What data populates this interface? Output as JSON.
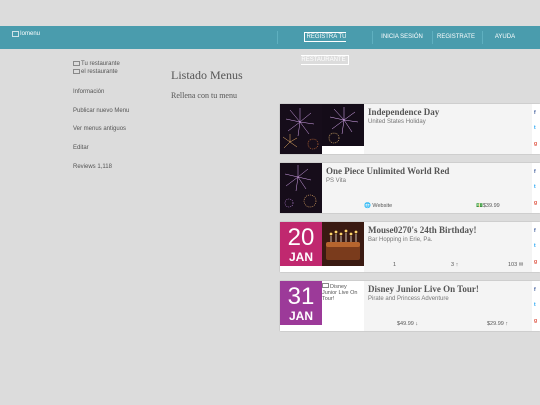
{
  "header": {
    "brand_alt": "Iomenu",
    "nav": [
      "REGISTRA TU RESTAURANTE",
      "INICIA SESIÓN",
      "REGISTRATE",
      "AYUDA"
    ]
  },
  "sidebar": {
    "title": "Tu restaurante",
    "logo_alt": "el restaurante",
    "items": [
      "Información",
      "Publicar nuevo Menu",
      "Ver menus antiguos",
      "Editar",
      "Reviews 1,118"
    ]
  },
  "main": {
    "title": "Listado Menus",
    "subtitle": "Rellena con tu menu"
  },
  "cards": [
    {
      "title": "Independence Day",
      "subtitle": "United States Holiday"
    },
    {
      "title": "One Piece Unlimited World Red",
      "subtitle": "PS Vita",
      "website": "Website",
      "price": "$39.99"
    },
    {
      "title": "Mouse0270's 24th Birthday!",
      "subtitle": "Bar Hopping in Erie, Pa.",
      "day": "20",
      "month": "JAN",
      "stat1": "1",
      "stat2": "3",
      "stat3": "103"
    },
    {
      "title": "Disney Junior Live On Tour!",
      "subtitle": "Pirate and Princess Adventure",
      "day": "31",
      "month": "JAN",
      "image_alt": "Disney Junior Live On Tour!",
      "price1": "$49.99",
      "price2": "$29.99"
    }
  ],
  "colors": {
    "navbar": "#4a9cad",
    "jan20": "#c0286f",
    "jan31": "#9c3a99",
    "facebook": "#3b5998",
    "twitter": "#1da1f2",
    "google": "#dd4b39"
  }
}
